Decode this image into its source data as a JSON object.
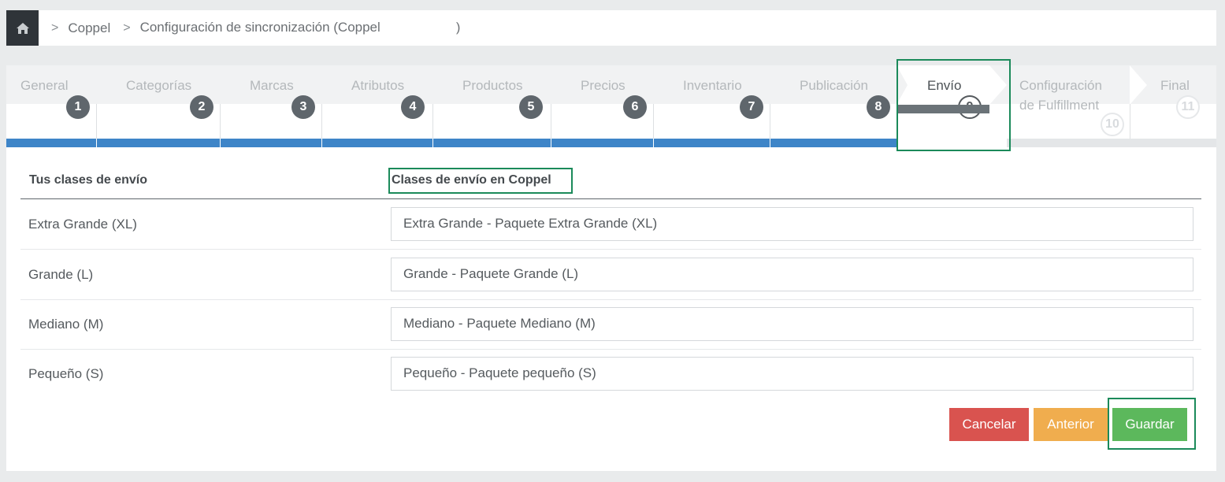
{
  "breadcrumb": {
    "home_icon": "home-icon",
    "items": [
      "Coppel",
      "Configuración de sincronización (Coppel",
      ")"
    ]
  },
  "wizard": {
    "steps": [
      {
        "label": "General",
        "num": "1"
      },
      {
        "label": "Categorías",
        "num": "2"
      },
      {
        "label": "Marcas",
        "num": "3"
      },
      {
        "label": "Atributos",
        "num": "4"
      },
      {
        "label": "Productos",
        "num": "5"
      },
      {
        "label": "Precios",
        "num": "6"
      },
      {
        "label": "Inventario",
        "num": "7"
      },
      {
        "label": "Publicación",
        "num": "8"
      },
      {
        "label": "Envío",
        "num": "9"
      },
      {
        "label": "Configuración",
        "label2": "de Fulfillment",
        "num": "10"
      },
      {
        "label": "Final",
        "num": "11"
      }
    ],
    "active_index": 8
  },
  "table": {
    "col1": "Tus clases de envío",
    "col2": "Clases de envío en Coppel",
    "rows": [
      {
        "label": "Extra Grande (XL)",
        "value": "Extra Grande - Paquete Extra Grande (XL)"
      },
      {
        "label": "Grande (L)",
        "value": "Grande - Paquete Grande (L)"
      },
      {
        "label": "Mediano (M)",
        "value": "Mediano - Paquete Mediano (M)"
      },
      {
        "label": "Pequeño (S)",
        "value": "Pequeño - Paquete pequeño (S)"
      }
    ]
  },
  "buttons": {
    "cancel": "Cancelar",
    "previous": "Anterior",
    "save": "Guardar"
  },
  "colors": {
    "progress": "#3e85c8",
    "cancel": "#d9534f",
    "previous": "#f0ad4e",
    "save": "#5cb85c",
    "highlight": "#1b8a5a"
  }
}
